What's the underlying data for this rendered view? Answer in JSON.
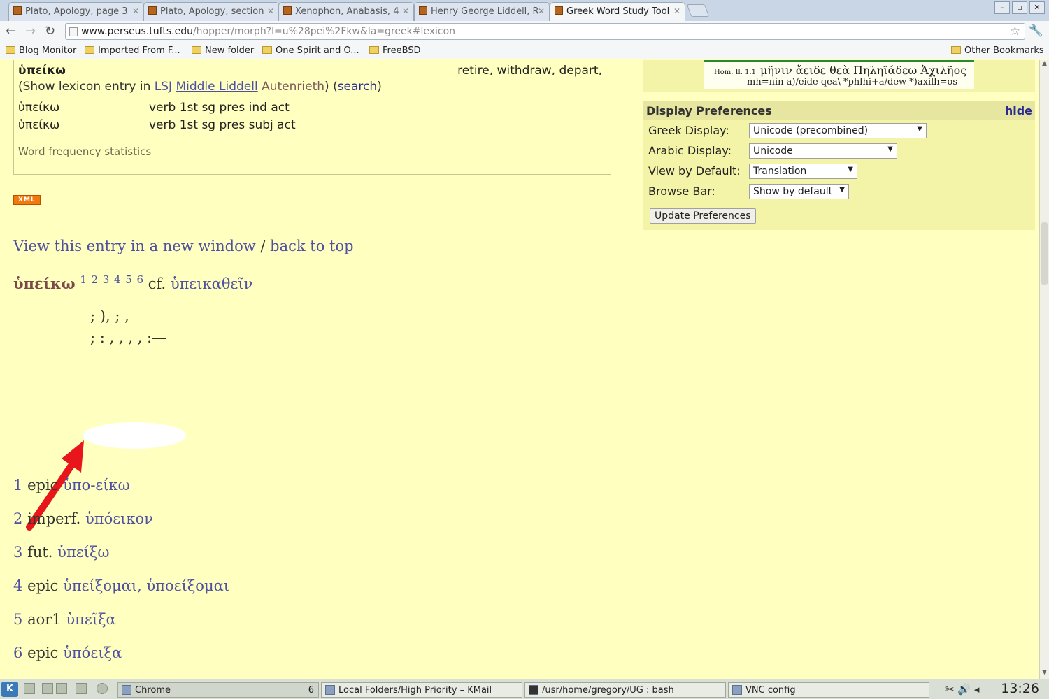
{
  "tabs": [
    {
      "title": "Plato, Apology, page 3",
      "active": false
    },
    {
      "title": "Plato, Apology, section",
      "active": false
    },
    {
      "title": "Xenophon, Anabasis, 4",
      "active": false
    },
    {
      "title": "Henry George Liddell, R",
      "active": false
    },
    {
      "title": "Greek Word Study Tool",
      "active": true
    }
  ],
  "toolbar": {
    "url_host": "www.perseus.tufts.edu",
    "url_rest": "/hopper/morph?l=u%28pei%2Fkw&la=greek#lexicon"
  },
  "bookmarks": [
    "Blog Monitor",
    "Imported From F...",
    "New folder",
    "One Spirit and O...",
    "FreeBSD"
  ],
  "other_bookmarks": "Other Bookmarks",
  "morph": {
    "lemma": "ὑπείκω",
    "gloss": "retire, withdraw, depart,",
    "show_prefix": "(Show lexicon entry in",
    "lsj": "LSJ",
    "middle_liddell": "Middle Liddell",
    "autenrieth": "Autenrieth",
    "show_mid": ") (",
    "search": "search",
    "show_suffix": ")",
    "forms": [
      {
        "form": "ὑπείκω",
        "analysis": "verb 1st sg pres ind act"
      },
      {
        "form": "ὑπείκω",
        "analysis": "verb 1st sg pres subj act"
      }
    ],
    "freq": "Word frequency statistics"
  },
  "xml_badge": "XML",
  "entry_nav": {
    "view_new": "View this entry in a new window",
    "sep": "/",
    "back_top": "back to top"
  },
  "entry": {
    "headword": "ὑπείκω",
    "refs": [
      "1",
      "2",
      "3",
      "4",
      "5",
      "6"
    ],
    "cf_label": "cf.",
    "cf_word": "ὑπεικαθεῖν"
  },
  "forms_list": [
    {
      "n": "1",
      "label": "epic",
      "greek": "ὑπο-είκω"
    },
    {
      "n": "2",
      "label": "imperf.",
      "greek": "ὑπόεικον"
    },
    {
      "n": "3",
      "label": "fut.",
      "greek": "ὑπείξω"
    },
    {
      "n": "4",
      "label": "epic",
      "greek": "ὑπείξομαι, ὑποείξομαι"
    },
    {
      "n": "5",
      "label": "aor1",
      "greek": "ὑπεῖξα"
    },
    {
      "n": "6",
      "label": "epic",
      "greek": "ὑπόειξα"
    }
  ],
  "sidebar": {
    "img_cite": "Hom. Il. 1.1",
    "img_greek": "μῆνιν ἄειδε θεὰ Πηληϊάδεω Ἀχιλῆος",
    "img_beta": "mh=nin a)/eide qea\\ *phlhi+a/dew *)axilh=os",
    "prefs_title": "Display Preferences",
    "hide": "hide",
    "prefs": [
      {
        "label": "Greek Display:",
        "value": "Unicode (precombined)"
      },
      {
        "label": "Arabic Display:",
        "value": "Unicode"
      },
      {
        "label": "View by Default:",
        "value": "Translation"
      },
      {
        "label": "Browse Bar:",
        "value": "Show by default"
      }
    ],
    "update": "Update Preferences"
  },
  "taskbar": {
    "tasks": [
      "Chrome",
      "Local Folders/High Priority – KMail",
      "/usr/home/gregory/UG : bash",
      "VNC config"
    ],
    "chrome_count": "6",
    "clock": "13:26"
  },
  "colors": {
    "page_bg": "#ffffc0",
    "link": "#5050a0",
    "arrow": "#e8161a"
  }
}
